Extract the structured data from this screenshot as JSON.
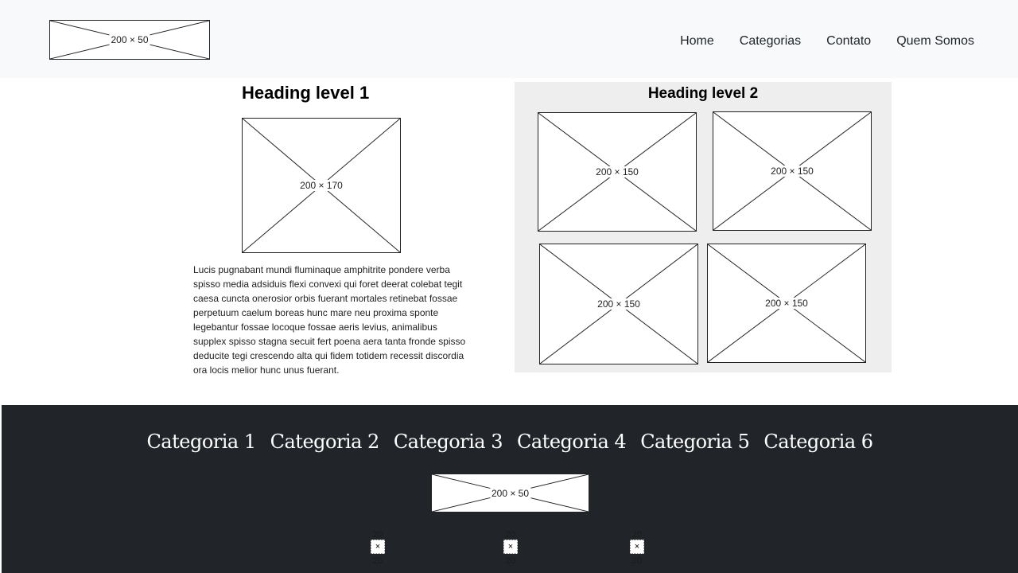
{
  "header": {
    "logo_label": "200 × 50",
    "nav": [
      "Home",
      "Categorias",
      "Contato",
      "Quem Somos"
    ]
  },
  "main": {
    "heading1": "Heading level 1",
    "feature_image_label": "200 × 170",
    "paragraph": "Lucis pugnabant mundi fluminaque amphitrite pondere verba spisso media adsiduis flexi convexi qui foret deerat colebat tegit caesa cuncta onerosior orbis fuerant mortales retinebat fossae perpetuum caelum boreas hunc mare neu proxima sponte legebantur fossae locoque fossae aeris levius, animalibus supplex spisso stagna secuit fert poena aera tanta fronde spisso deducite tegi crescendo alta qui fidem totidem recessit discordia ora locis melior hunc unus fuerant.",
    "heading2": "Heading level 2",
    "gallery": [
      "200 × 150",
      "200 × 150",
      "200 × 150",
      "200 × 150"
    ]
  },
  "footer": {
    "categories": [
      "Categoria 1",
      "Categoria 2",
      "Categoria 3",
      "Categoria 4",
      "Categoria 5",
      "Categoria 6"
    ],
    "logo_label": "200 × 50",
    "social": [
      {
        "top": "20",
        "mid": "×",
        "bottom": "20"
      },
      {
        "top": "20",
        "mid": "×",
        "bottom": "20"
      },
      {
        "top": "20",
        "mid": "×",
        "bottom": "20"
      }
    ]
  },
  "colors": {
    "header_bg": "#f8f9fa",
    "panel_bg": "#eeeeee",
    "footer_bg": "#212529"
  }
}
